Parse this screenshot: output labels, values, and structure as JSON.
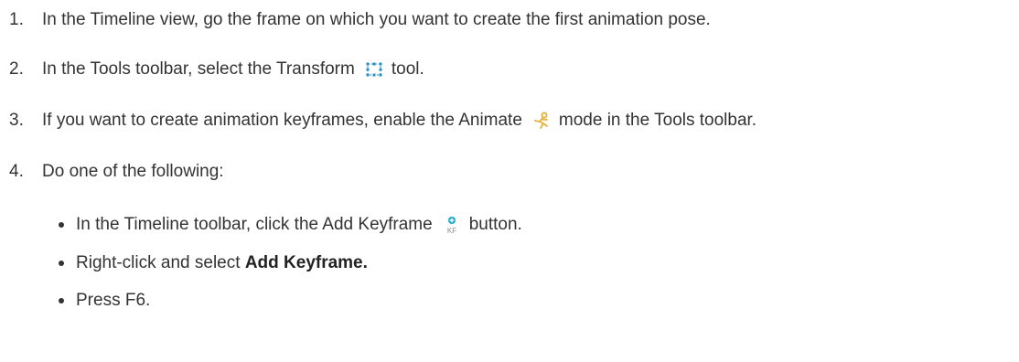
{
  "steps": [
    {
      "number": "1.",
      "text": "In the Timeline view, go the frame on which you want to create the first animation pose."
    },
    {
      "number": "2.",
      "text_before": "In the Tools toolbar, select the Transform",
      "icon": "transform-tool-icon",
      "text_after": "tool."
    },
    {
      "number": "3.",
      "text_before": "If you want to create animation keyframes, enable the Animate",
      "icon": "animate-mode-icon",
      "text_after": "mode in the Tools toolbar."
    },
    {
      "number": "4.",
      "text": "Do one of the following:"
    }
  ],
  "sub_items": [
    {
      "text_before": "In the Timeline toolbar, click the Add Keyframe",
      "icon": "add-keyframe-icon",
      "text_after": "button."
    },
    {
      "text_before": "Right-click and select",
      "bold": "Add Keyframe."
    },
    {
      "text": "Press F6."
    }
  ],
  "colors": {
    "text": "#333333",
    "transform_icon": "#2a8fc8",
    "animate_icon": "#e2b13a",
    "keyframe_icon": "#1aa8cf"
  }
}
